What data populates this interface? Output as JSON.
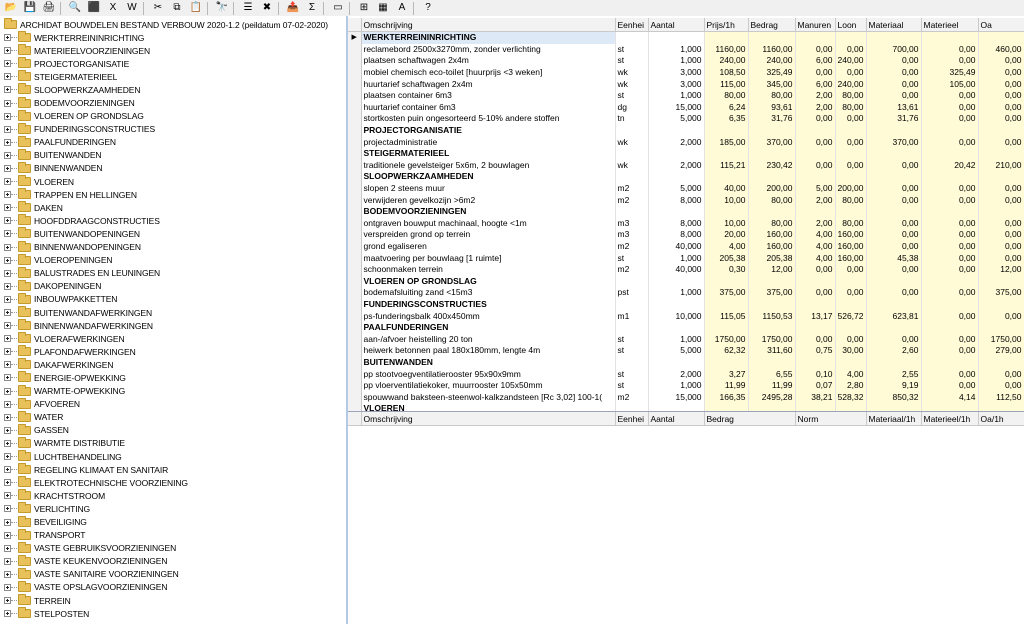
{
  "colors": {
    "folder": "#e8c15a",
    "highlight_cells": "#fffbd6",
    "splitter": "#b5c9e6"
  },
  "toolbar": {
    "icons": [
      {
        "name": "open-folder-icon",
        "glyph": "📂"
      },
      {
        "name": "save-icon",
        "glyph": "💾"
      },
      {
        "name": "print-icon",
        "glyph": "🖨"
      },
      {
        "name": "print-preview-icon",
        "glyph": "🔍"
      },
      {
        "name": "pdf-icon",
        "glyph": "⬛"
      },
      {
        "name": "excel-icon",
        "glyph": "X"
      },
      {
        "name": "word-icon",
        "glyph": "W"
      },
      {
        "name": "cut-icon",
        "glyph": "✂"
      },
      {
        "name": "copy-icon",
        "glyph": "⧉"
      },
      {
        "name": "paste-icon",
        "glyph": "📋"
      },
      {
        "name": "find-icon",
        "glyph": "🔭"
      },
      {
        "name": "indent-icon",
        "glyph": "☰"
      },
      {
        "name": "delete-icon",
        "glyph": "✖"
      },
      {
        "name": "export-icon",
        "glyph": "📤"
      },
      {
        "name": "sum-icon",
        "glyph": "Σ"
      },
      {
        "name": "split-view-icon",
        "glyph": "▭"
      },
      {
        "name": "tree-structure-icon",
        "glyph": "⊞"
      },
      {
        "name": "filter-icon",
        "glyph": "▦"
      },
      {
        "name": "spell-check-icon",
        "glyph": "A"
      },
      {
        "name": "help-icon",
        "glyph": "?"
      }
    ]
  },
  "tree": {
    "root_label": "ARCHIDAT BOUWDELEN BESTAND VERBOUW 2020-1.2 (peildatum 07-02-2020)",
    "items": [
      "WERKTERREININRICHTING",
      "MATERIEELVOORZIENINGEN",
      "PROJECTORGANISATIE",
      "STEIGERMATERIEEL",
      "SLOOPWERKZAAMHEDEN",
      "BODEMVOORZIENINGEN",
      "VLOEREN OP GRONDSLAG",
      "FUNDERINGSCONSTRUCTIES",
      "PAALFUNDERINGEN",
      "BUITENWANDEN",
      "BINNENWANDEN",
      "VLOEREN",
      "TRAPPEN EN HELLINGEN",
      "DAKEN",
      "HOOFDDRAAGCONSTRUCTIES",
      "BUITENWANDOPENINGEN",
      "BINNENWANDOPENINGEN",
      "VLOEROPENINGEN",
      "BALUSTRADES EN LEUNINGEN",
      "DAKOPENINGEN",
      "INBOUWPAKKETTEN",
      "BUITENWANDAFWERKINGEN",
      "BINNENWANDAFWERKINGEN",
      "VLOERAFWERKINGEN",
      "PLAFONDAFWERKINGEN",
      "DAKAFWERKINGEN",
      "ENERGIE-OPWEKKING",
      "WARMTE-OPWEKKING",
      "AFVOEREN",
      "WATER",
      "GASSEN",
      "WARMTE DISTRIBUTIE",
      "LUCHTBEHANDELING",
      "REGELING KLIMAAT EN SANITAIR",
      "ELEKTROTECHNISCHE VOORZIENING",
      "KRACHTSTROOM",
      "VERLICHTING",
      "BEVEILIGING",
      "TRANSPORT",
      "VASTE GEBRUIKSVOORZIENINGEN",
      "VASTE KEUKENVOORZIENINGEN",
      "VASTE SANITAIRE VOORZIENINGEN",
      "VASTE OPSLAGVOORZIENINGEN",
      "TERREIN",
      "STELPOSTEN"
    ]
  },
  "grid": {
    "columns": [
      "Omschrijving",
      "Eenhei",
      "Aantal",
      "Prijs/1h",
      "Bedrag",
      "Manuren",
      "Loon",
      "Materiaal",
      "Materieel",
      "Oa"
    ],
    "rows": [
      {
        "header": true,
        "selected": true,
        "desc": "WERKTERREININRICHTING"
      },
      {
        "desc": "reclamebord 2500x3270mm, zonder verlichting",
        "unit": "st",
        "qty": "1,000",
        "price": "1160,00",
        "amount": "1160,00",
        "hours": "0,00",
        "wage": "0,00",
        "mat": "700,00",
        "equip": "0,00",
        "oa": "460,00"
      },
      {
        "desc": "plaatsen schaftwagen 2x4m",
        "unit": "st",
        "qty": "1,000",
        "price": "240,00",
        "amount": "240,00",
        "hours": "6,00",
        "wage": "240,00",
        "mat": "0,00",
        "equip": "0,00",
        "oa": "0,00"
      },
      {
        "desc": "mobiel chemisch eco-toilet [huurprijs <3 weken]",
        "unit": "wk",
        "qty": "3,000",
        "price": "108,50",
        "amount": "325,49",
        "hours": "0,00",
        "wage": "0,00",
        "mat": "0,00",
        "equip": "325,49",
        "oa": "0,00"
      },
      {
        "desc": "huurtarief schaftwagen 2x4m",
        "unit": "wk",
        "qty": "3,000",
        "price": "115,00",
        "amount": "345,00",
        "hours": "6,00",
        "wage": "240,00",
        "mat": "0,00",
        "equip": "105,00",
        "oa": "0,00"
      },
      {
        "desc": "plaatsen container 6m3",
        "unit": "st",
        "qty": "1,000",
        "price": "80,00",
        "amount": "80,00",
        "hours": "2,00",
        "wage": "80,00",
        "mat": "0,00",
        "equip": "0,00",
        "oa": "0,00"
      },
      {
        "desc": "huurtarief container 6m3",
        "unit": "dg",
        "qty": "15,000",
        "price": "6,24",
        "amount": "93,61",
        "hours": "2,00",
        "wage": "80,00",
        "mat": "13,61",
        "equip": "0,00",
        "oa": "0,00"
      },
      {
        "desc": "stortkosten puin ongesorteerd 5-10% andere stoffen",
        "unit": "tn",
        "qty": "5,000",
        "price": "6,35",
        "amount": "31,76",
        "hours": "0,00",
        "wage": "0,00",
        "mat": "31,76",
        "equip": "0,00",
        "oa": "0,00"
      },
      {
        "header": true,
        "desc": "PROJECTORGANISATIE"
      },
      {
        "desc": "projectadministratie",
        "unit": "wk",
        "qty": "2,000",
        "price": "185,00",
        "amount": "370,00",
        "hours": "0,00",
        "wage": "0,00",
        "mat": "370,00",
        "equip": "0,00",
        "oa": "0,00"
      },
      {
        "header": true,
        "desc": "STEIGERMATERIEEL"
      },
      {
        "desc": "traditionele gevelsteiger 5x6m, 2 bouwlagen",
        "unit": "wk",
        "qty": "2,000",
        "price": "115,21",
        "amount": "230,42",
        "hours": "0,00",
        "wage": "0,00",
        "mat": "0,00",
        "equip": "20,42",
        "oa": "210,00"
      },
      {
        "header": true,
        "desc": "SLOOPWERKZAAMHEDEN"
      },
      {
        "desc": "slopen 2 steens muur",
        "unit": "m2",
        "qty": "5,000",
        "price": "40,00",
        "amount": "200,00",
        "hours": "5,00",
        "wage": "200,00",
        "mat": "0,00",
        "equip": "0,00",
        "oa": "0,00"
      },
      {
        "desc": "verwijderen gevelkozijn >6m2",
        "unit": "m2",
        "qty": "8,000",
        "price": "10,00",
        "amount": "80,00",
        "hours": "2,00",
        "wage": "80,00",
        "mat": "0,00",
        "equip": "0,00",
        "oa": "0,00"
      },
      {
        "header": true,
        "desc": "BODEMVOORZIENINGEN"
      },
      {
        "desc": "ontgraven bouwput machinaal, hoogte <1m",
        "unit": "m3",
        "qty": "8,000",
        "price": "10,00",
        "amount": "80,00",
        "hours": "2,00",
        "wage": "80,00",
        "mat": "0,00",
        "equip": "0,00",
        "oa": "0,00"
      },
      {
        "desc": "verspreiden grond op terrein",
        "unit": "m3",
        "qty": "8,000",
        "price": "20,00",
        "amount": "160,00",
        "hours": "4,00",
        "wage": "160,00",
        "mat": "0,00",
        "equip": "0,00",
        "oa": "0,00"
      },
      {
        "desc": "grond egaliseren",
        "unit": "m2",
        "qty": "40,000",
        "price": "4,00",
        "amount": "160,00",
        "hours": "4,00",
        "wage": "160,00",
        "mat": "0,00",
        "equip": "0,00",
        "oa": "0,00"
      },
      {
        "desc": "maatvoering per bouwlaag [1 ruimte]",
        "unit": "st",
        "qty": "1,000",
        "price": "205,38",
        "amount": "205,38",
        "hours": "4,00",
        "wage": "160,00",
        "mat": "45,38",
        "equip": "0,00",
        "oa": "0,00"
      },
      {
        "desc": "schoonmaken terrein",
        "unit": "m2",
        "qty": "40,000",
        "price": "0,30",
        "amount": "12,00",
        "hours": "0,00",
        "wage": "0,00",
        "mat": "0,00",
        "equip": "0,00",
        "oa": "12,00"
      },
      {
        "header": true,
        "desc": "VLOEREN OP GRONDSLAG"
      },
      {
        "desc": "bodemafsluiting zand <15m3",
        "unit": "pst",
        "qty": "1,000",
        "price": "375,00",
        "amount": "375,00",
        "hours": "0,00",
        "wage": "0,00",
        "mat": "0,00",
        "equip": "0,00",
        "oa": "375,00"
      },
      {
        "header": true,
        "desc": "FUNDERINGSCONSTRUCTIES"
      },
      {
        "desc": "ps-funderingsbalk 400x450mm",
        "unit": "m1",
        "qty": "10,000",
        "price": "115,05",
        "amount": "1150,53",
        "hours": "13,17",
        "wage": "526,72",
        "mat": "623,81",
        "equip": "0,00",
        "oa": "0,00"
      },
      {
        "header": true,
        "desc": "PAALFUNDERINGEN"
      },
      {
        "desc": "aan-/afvoer heistelling 20 ton",
        "unit": "st",
        "qty": "1,000",
        "price": "1750,00",
        "amount": "1750,00",
        "hours": "0,00",
        "wage": "0,00",
        "mat": "0,00",
        "equip": "0,00",
        "oa": "1750,00"
      },
      {
        "desc": "heiwerk betonnen paal 180x180mm, lengte 4m",
        "unit": "st",
        "qty": "5,000",
        "price": "62,32",
        "amount": "311,60",
        "hours": "0,75",
        "wage": "30,00",
        "mat": "2,60",
        "equip": "0,00",
        "oa": "279,00"
      },
      {
        "header": true,
        "desc": "BUITENWANDEN"
      },
      {
        "desc": "pp stootvoegventilatierooster 95x90x9mm",
        "unit": "st",
        "qty": "2,000",
        "price": "3,27",
        "amount": "6,55",
        "hours": "0,10",
        "wage": "4,00",
        "mat": "2,55",
        "equip": "0,00",
        "oa": "0,00"
      },
      {
        "desc": "pp vloerventilatiekoker, muurrooster 105x50mm",
        "unit": "st",
        "qty": "1,000",
        "price": "11,99",
        "amount": "11,99",
        "hours": "0,07",
        "wage": "2,80",
        "mat": "9,19",
        "equip": "0,00",
        "oa": "0,00"
      },
      {
        "desc": "spouwwand baksteen-steenwol-kalkzandsteen [Rc 3,02] 100-1(",
        "unit": "m2",
        "qty": "15,000",
        "price": "166,35",
        "amount": "2495,28",
        "hours": "38,21",
        "wage": "528,32",
        "mat": "850,32",
        "equip": "4,14",
        "oa": "112,50"
      },
      {
        "header": true,
        "desc": "VLOEREN"
      }
    ]
  },
  "detail": {
    "columns": [
      "Omschrijving",
      "Eenhei",
      "Aantal",
      "Bedrag",
      "Norm",
      "Materiaal/1h",
      "Materieel/1h",
      "Oa/1h"
    ]
  }
}
